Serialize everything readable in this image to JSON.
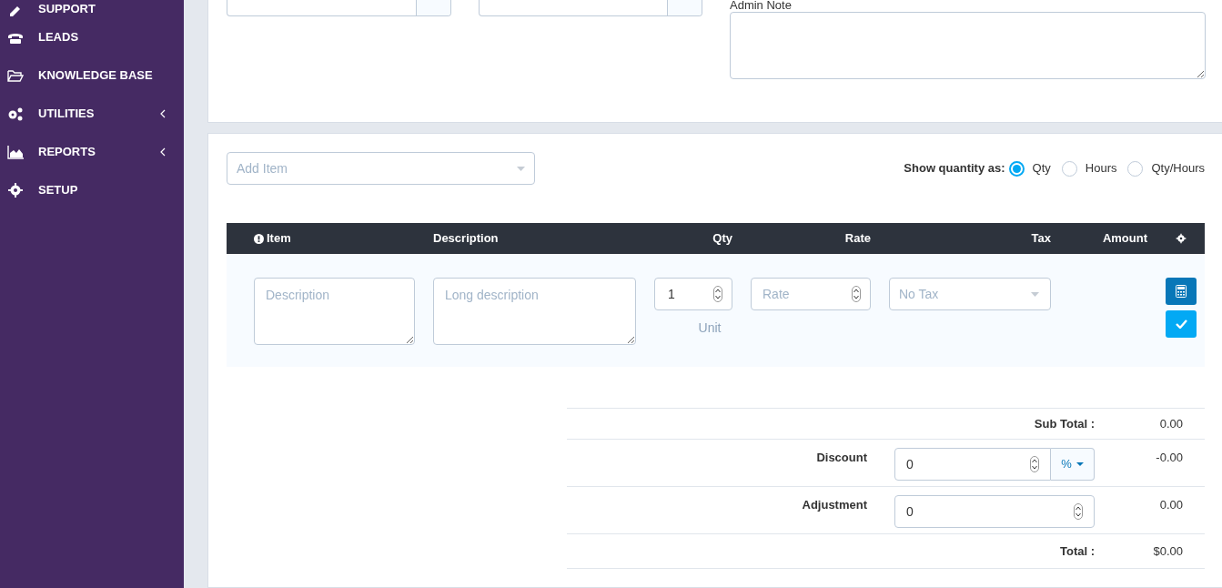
{
  "sidebar": {
    "items": [
      {
        "label": "SUPPORT",
        "has_submenu": false
      },
      {
        "label": "LEADS",
        "has_submenu": false
      },
      {
        "label": "KNOWLEDGE BASE",
        "has_submenu": false
      },
      {
        "label": "UTILITIES",
        "has_submenu": true
      },
      {
        "label": "REPORTS",
        "has_submenu": true
      },
      {
        "label": "SETUP",
        "has_submenu": false
      }
    ]
  },
  "top_form": {
    "admin_note": {
      "label": "Admin Note"
    }
  },
  "items": {
    "add_item": {
      "placeholder": "Add Item"
    },
    "quantity_mode": {
      "label": "Show quantity as:",
      "options": [
        {
          "label": "Qty",
          "selected": true
        },
        {
          "label": "Hours",
          "selected": false
        },
        {
          "label": "Qty/Hours",
          "selected": false
        }
      ]
    },
    "columns": [
      "Item",
      "Description",
      "Qty",
      "Rate",
      "Tax",
      "Amount"
    ],
    "new_row": {
      "description": {
        "placeholder": "Description"
      },
      "long_description": {
        "placeholder": "Long description"
      },
      "qty": {
        "value": "1"
      },
      "unit": "Unit",
      "rate": {
        "placeholder": "Rate"
      },
      "tax": {
        "placeholder": "No Tax"
      }
    },
    "totals": {
      "sub_total": {
        "label": "Sub Total :",
        "value": "0.00"
      },
      "discount": {
        "label": "Discount",
        "input": "0",
        "type_button": "%",
        "value": "-0.00"
      },
      "adjustment": {
        "label": "Adjustment",
        "input": "0",
        "value": "0.00"
      },
      "total": {
        "label": "Total :",
        "value": "$0.00"
      }
    }
  }
}
